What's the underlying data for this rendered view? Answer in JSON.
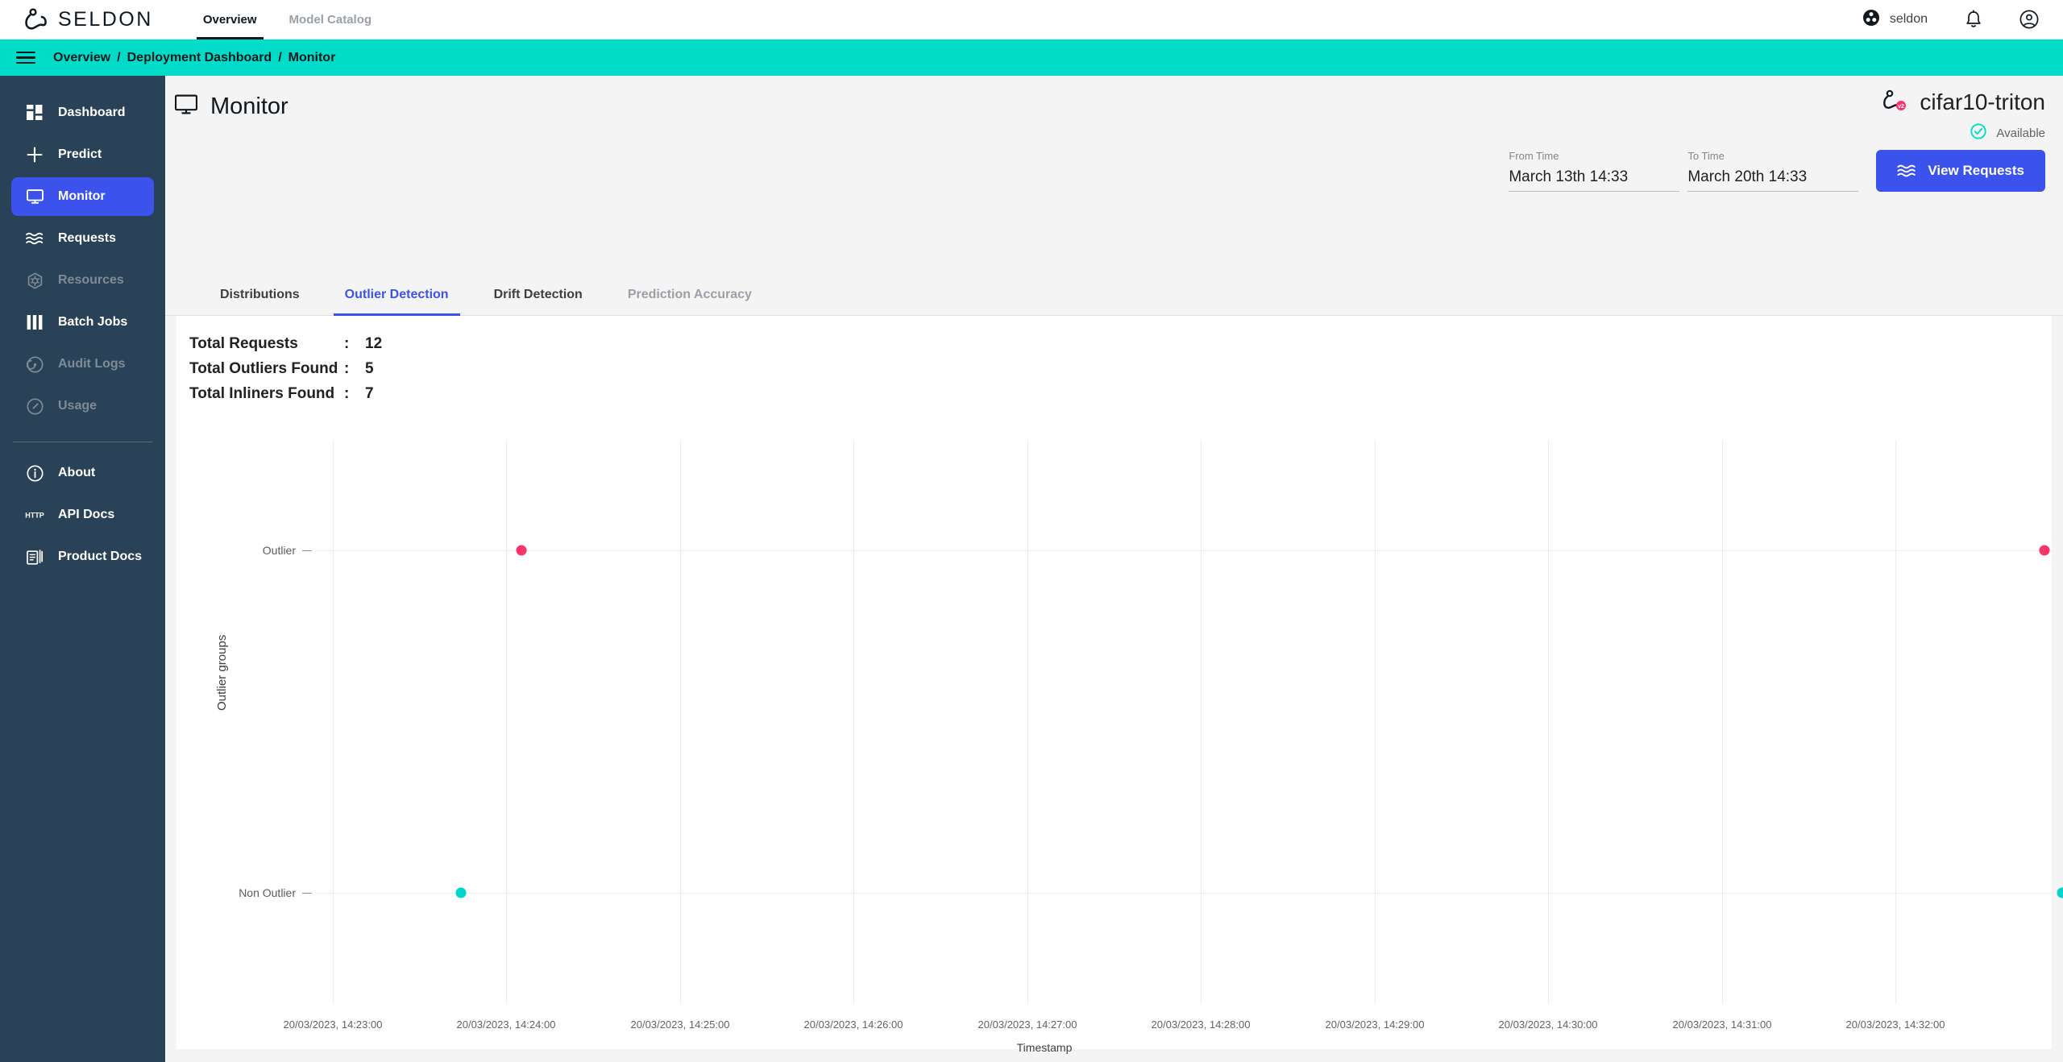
{
  "topbar": {
    "logo_text": "SELDON",
    "nav": [
      {
        "label": "Overview",
        "active": true
      },
      {
        "label": "Model Catalog",
        "active": false
      }
    ],
    "org_name": "seldon",
    "org_icon": "seldon-org-icon",
    "bell_icon": "notification-bell-icon",
    "account_icon": "account-circle-icon"
  },
  "breadcrumb": {
    "menu_icon": "hamburger-menu-icon",
    "items": [
      "Overview",
      "Deployment Dashboard",
      "Monitor"
    ],
    "separator": "/",
    "bg_color": "#00DCC8"
  },
  "sidebar": {
    "items": [
      {
        "label": "Dashboard",
        "icon": "dashboard-grid-icon",
        "state": "normal"
      },
      {
        "label": "Predict",
        "icon": "plus-icon",
        "state": "normal"
      },
      {
        "label": "Monitor",
        "icon": "monitor-screen-icon",
        "state": "active"
      },
      {
        "label": "Requests",
        "icon": "waves-icon",
        "state": "normal"
      },
      {
        "label": "Resources",
        "icon": "kubernetes-helm-icon",
        "state": "disabled"
      },
      {
        "label": "Batch Jobs",
        "icon": "columns-bars-icon",
        "state": "normal"
      },
      {
        "label": "Audit Logs",
        "icon": "audit-target-icon",
        "state": "disabled"
      },
      {
        "label": "Usage",
        "icon": "gauge-icon",
        "state": "disabled"
      }
    ],
    "footer_items": [
      {
        "label": "About",
        "icon": "info-circle-icon",
        "state": "normal"
      },
      {
        "label": "API Docs",
        "icon": "http-text-icon",
        "state": "normal"
      },
      {
        "label": "Product Docs",
        "icon": "documents-icon",
        "state": "normal"
      }
    ],
    "active_color": "#3b53ec",
    "bg_color": "#2a4257"
  },
  "page": {
    "title": "Monitor",
    "title_icon": "monitor-screen-icon",
    "deployment_name": "cifar10-triton",
    "deployment_icon": "deployment-v2-icon",
    "deployment_version_badge": "v2",
    "status_text": "Available",
    "status_icon": "check-circle-icon",
    "status_color": "#00DCC8"
  },
  "time_range": {
    "from_label": "From Time",
    "from_value": "March 13th 14:33",
    "to_label": "To Time",
    "to_value": "March 20th 14:33",
    "view_requests_label": "View Requests",
    "view_requests_icon": "waves-icon",
    "button_color": "#3b53ec"
  },
  "tabs": [
    {
      "label": "Distributions",
      "state": "normal"
    },
    {
      "label": "Outlier Detection",
      "state": "active"
    },
    {
      "label": "Drift Detection",
      "state": "normal"
    },
    {
      "label": "Prediction Accuracy",
      "state": "muted"
    }
  ],
  "stats": [
    {
      "label": "Total Requests",
      "colon": ":",
      "value": "12"
    },
    {
      "label": "Total Outliers Found",
      "colon": ":",
      "value": "5"
    },
    {
      "label": "Total Inliners Found",
      "colon": ":",
      "value": "7"
    }
  ],
  "chart_data": {
    "type": "scatter",
    "title": "",
    "xlabel": "Timestamp",
    "ylabel": "Outlier groups",
    "grid": "vertical-and-category-lines",
    "legend": "none",
    "y_categories": [
      "Outlier",
      "Non Outlier"
    ],
    "x_tick_labels": [
      "20/03/2023, 14:23:00",
      "20/03/2023, 14:24:00",
      "20/03/2023, 14:25:00",
      "20/03/2023, 14:26:00",
      "20/03/2023, 14:27:00",
      "20/03/2023, 14:28:00",
      "20/03/2023, 14:29:00",
      "20/03/2023, 14:30:00",
      "20/03/2023, 14:31:00",
      "20/03/2023, 14:32:00"
    ],
    "series": [
      {
        "name": "Outlier",
        "color": "#f9366c",
        "count": 5,
        "points": [
          {
            "x": "20/03/2023, 14:23:07",
            "y": "Outlier",
            "px": 0.119,
            "py": 0.195
          },
          {
            "x": "20/03/2023, 14:31:50",
            "y": "Outlier",
            "px": 0.996,
            "py": 0.195
          },
          {
            "x": "20/03/2023, 14:32:08",
            "y": "Outlier",
            "px": 1.014,
            "py": 0.174
          },
          {
            "x": "20/03/2023, 14:32:08",
            "y": "Outlier",
            "px": 1.014,
            "py": 0.195
          },
          {
            "x": "20/03/2023, 14:32:08",
            "y": "Outlier",
            "px": 1.014,
            "py": 0.216
          }
        ]
      },
      {
        "name": "Non Outlier",
        "color": "#00D5CD",
        "count": 7,
        "points": [
          {
            "x": "20/03/2023, 14:22:50",
            "y": "Non Outlier",
            "px": 0.084,
            "py": 0.803
          },
          {
            "x": "20/03/2023, 14:32:00",
            "y": "Non Outlier",
            "px": 1.006,
            "py": 0.803
          },
          {
            "x": "20/03/2023, 14:32:10",
            "y": "Non Outlier",
            "px": 1.016,
            "py": 0.778
          },
          {
            "x": "20/03/2023, 14:32:10",
            "y": "Non Outlier",
            "px": 1.016,
            "py": 0.791
          },
          {
            "x": "20/03/2023, 14:32:10",
            "y": "Non Outlier",
            "px": 1.016,
            "py": 0.803
          },
          {
            "x": "20/03/2023, 14:32:10",
            "y": "Non Outlier",
            "px": 1.016,
            "py": 0.816
          },
          {
            "x": "20/03/2023, 14:32:10",
            "y": "Non Outlier",
            "px": 1.016,
            "py": 0.829
          }
        ]
      }
    ]
  }
}
